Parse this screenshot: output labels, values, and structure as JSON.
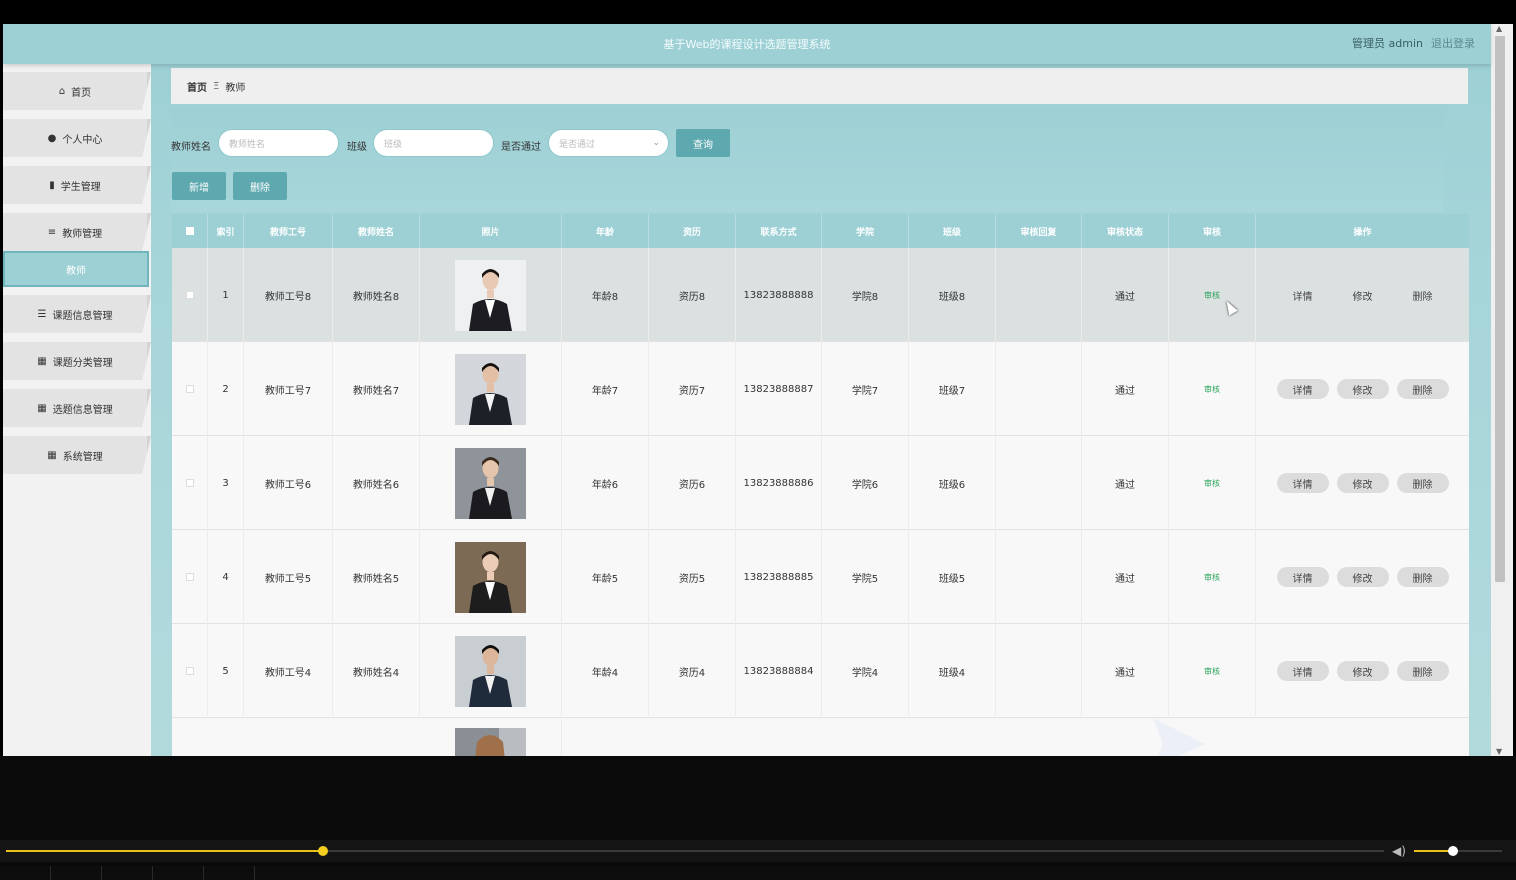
{
  "header": {
    "title": "基于Web的课程设计选题管理系统",
    "user": "管理员 admin",
    "logout": "退出登录"
  },
  "sidebar": {
    "items": [
      {
        "label": "首页",
        "icon": "home-icon"
      },
      {
        "label": "个人中心",
        "icon": "user-icon"
      },
      {
        "label": "学生管理",
        "icon": "clipboard-icon"
      },
      {
        "label": "教师管理",
        "icon": "list-icon"
      },
      {
        "label": "教师",
        "icon": "",
        "active": true
      },
      {
        "label": "课题信息管理",
        "icon": "sliders-icon"
      },
      {
        "label": "课题分类管理",
        "icon": "grid-icon"
      },
      {
        "label": "选题信息管理",
        "icon": "grid-icon"
      },
      {
        "label": "系统管理",
        "icon": "grid-icon"
      }
    ]
  },
  "breadcrumb": {
    "home": "首页",
    "separator": "Ξ",
    "current": "教师"
  },
  "search": {
    "name_label": "教师姓名",
    "name_placeholder": "教师姓名",
    "class_label": "班级",
    "class_placeholder": "班级",
    "passed_label": "是否通过",
    "passed_placeholder": "是否通过",
    "query_button": "查询",
    "add_button": "新增",
    "delete_button": "删除"
  },
  "table": {
    "headers": [
      "索引",
      "教师工号",
      "教师姓名",
      "照片",
      "年龄",
      "资历",
      "联系方式",
      "学院",
      "班级",
      "审核回复",
      "审核状态",
      "审核",
      "操作"
    ],
    "rows": [
      {
        "index": "1",
        "id": "教师工号8",
        "name": "教师姓名8",
        "age": "年龄8",
        "seniority": "资历8",
        "contact": "13823888888",
        "college": "学院8",
        "class": "班级8",
        "reply": "",
        "status": "通过",
        "audit": "审核"
      },
      {
        "index": "2",
        "id": "教师工号7",
        "name": "教师姓名7",
        "age": "年龄7",
        "seniority": "资历7",
        "contact": "13823888887",
        "college": "学院7",
        "class": "班级7",
        "reply": "",
        "status": "通过",
        "audit": "审核"
      },
      {
        "index": "3",
        "id": "教师工号6",
        "name": "教师姓名6",
        "age": "年龄6",
        "seniority": "资历6",
        "contact": "13823888886",
        "college": "学院6",
        "class": "班级6",
        "reply": "",
        "status": "通过",
        "audit": "审核"
      },
      {
        "index": "4",
        "id": "教师工号5",
        "name": "教师姓名5",
        "age": "年龄5",
        "seniority": "资历5",
        "contact": "13823888885",
        "college": "学院5",
        "class": "班级5",
        "reply": "",
        "status": "通过",
        "audit": "审核"
      },
      {
        "index": "5",
        "id": "教师工号4",
        "name": "教师姓名4",
        "age": "年龄4",
        "seniority": "资历4",
        "contact": "13823888884",
        "college": "学院4",
        "class": "班级4",
        "reply": "",
        "status": "通过",
        "audit": "审核"
      }
    ],
    "ops": {
      "detail": "详情",
      "edit": "修改",
      "delete": "删除"
    }
  },
  "player": {
    "progress": 0.23,
    "volume": 0.4
  },
  "colors": {
    "accent": "#9dd0d5",
    "button": "#5ea9b0",
    "audit_link": "#2aa35a",
    "progress": "#e8c21b"
  }
}
